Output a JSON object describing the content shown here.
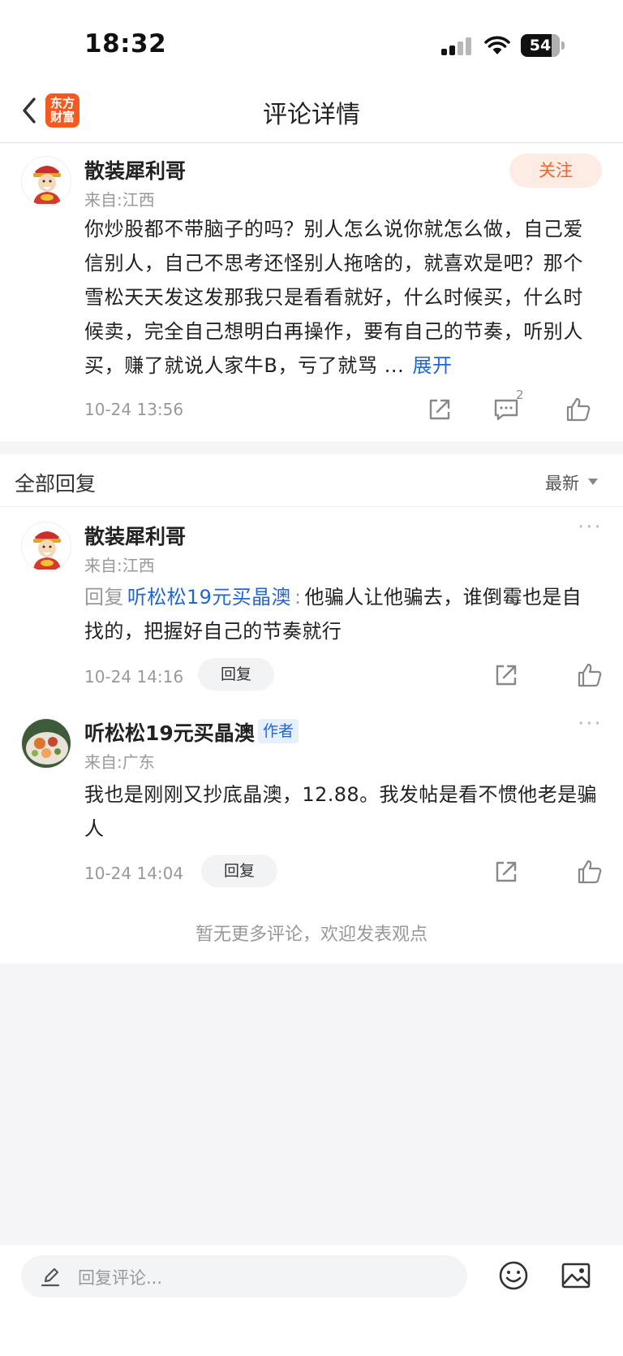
{
  "status_bar": {
    "time": "18:32",
    "battery": "54"
  },
  "nav": {
    "title": "评论详情",
    "logo_line1": "东方",
    "logo_line2": "财富"
  },
  "main_comment": {
    "username": "散装犀利哥",
    "location": "来自:江西",
    "follow_label": "关注",
    "text": "你炒股都不带脑子的吗？别人怎么说你就怎么做，自己爱信别人，自己不思考还怪别人拖啥的，就喜欢是吧？那个雪松天天发这发那我只是看看就好，什么时候买，什么时候卖，完全自己想明白再操作，要有自己的节奏，听别人买，赚了就说人家牛B，亏了就骂 ...",
    "expand_label": "展开",
    "time": "10-24 13:56",
    "comment_count": "2"
  },
  "replies_header": {
    "title": "全部回复",
    "sort": "最新"
  },
  "replies": [
    {
      "username": "散装犀利哥",
      "location": "来自:江西",
      "reply_prefix": "回复",
      "reply_target": "听松松19元买晶澳",
      "reply_separator": ":",
      "text": "他骗人让他骗去，谁倒霉也是自找的，把握好自己的节奏就行",
      "time": "10-24 14:16",
      "reply_label": "回复"
    },
    {
      "username": "听松松19元买晶澳",
      "author_tag": "作者",
      "location": "来自:广东",
      "text": "我也是刚刚又抄底晶澳，12.88。我发帖是看不惯他老是骗人",
      "time": "10-24 14:04",
      "reply_label": "回复"
    }
  ],
  "end_note": "暂无更多评论，欢迎发表观点",
  "input": {
    "placeholder": "回复评论..."
  },
  "colors": {
    "brand": "#f35a22",
    "link": "#1f66d6",
    "follow_bg": "#fdece4",
    "follow_text": "#f3622d"
  },
  "icons": [
    "back-icon",
    "share-icon",
    "comment-icon",
    "like-icon",
    "more-icon",
    "pencil-icon",
    "emoji-icon",
    "image-icon"
  ]
}
